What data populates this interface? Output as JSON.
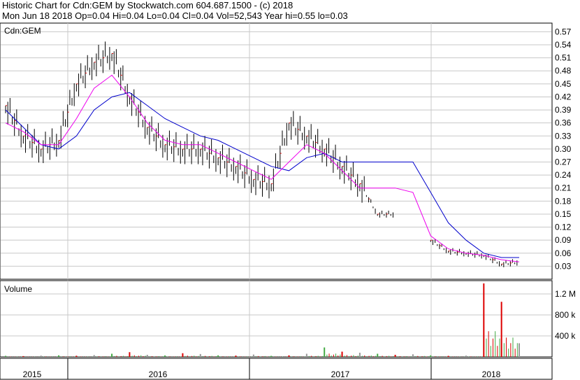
{
  "header": {
    "line1": "Historic Chart for Cdn:GEM by Stockwatch.com 604.687.1500 - (c) 2018",
    "line2": "Mon Jun 18 2018  Op=0.04  Hi=0.04  Lo=0.04  Cl=0.04  Vol=52,543  Year hi=0.55  lo=0.03"
  },
  "colors": {
    "price_bar": "#000000",
    "down_tick": "#dd0000",
    "ma_short": "#ee00ee",
    "ma_long": "#0000cc",
    "vol_up": "#44aa44",
    "vol_down": "#dd0000",
    "vol_flat": "#999999",
    "grid": "#c8c8c8"
  },
  "chart_data": [
    {
      "type": "line",
      "title": "Cdn:GEM",
      "ylim": [
        0.0,
        0.59
      ],
      "y_ticks": [
        "0.57",
        "0.54",
        "0.51",
        "0.48",
        "0.45",
        "0.42",
        "0.39",
        "0.36",
        "0.33",
        "0.30",
        "0.27",
        "0.24",
        "0.21",
        "0.18",
        "0.15",
        "0.12",
        "0.09",
        "0.06",
        "0.03"
      ],
      "x_ticks": [
        "2015",
        "2016",
        "2017",
        "2018"
      ],
      "x": [
        "2015-07",
        "2015-09",
        "2015-11",
        "2016-01",
        "2016-02",
        "2016-03",
        "2016-04",
        "2016-05",
        "2016-06",
        "2016-07",
        "2016-08",
        "2016-09",
        "2016-10",
        "2016-11",
        "2016-12",
        "2017-01",
        "2017-02",
        "2017-03",
        "2017-04",
        "2017-05",
        "2017-06",
        "2017-07",
        "2017-09",
        "2017-11",
        "2017-12",
        "2018-01",
        "2018-03",
        "2018-04",
        "2018-05",
        "2018-06"
      ],
      "series": [
        {
          "values": [
            0.4,
            0.33,
            0.3,
            0.32,
            0.45,
            0.5,
            0.52,
            0.42,
            0.35,
            0.31,
            0.3,
            0.3,
            0.28,
            0.26,
            0.23,
            0.22,
            0.36,
            0.33,
            0.3,
            0.26,
            0.22,
            0.15,
            0.15,
            0.15,
            0.09,
            0.065,
            0.06,
            0.055,
            0.035,
            0.04
          ]
        },
        {
          "values": [
            0.36,
            0.34,
            0.31,
            0.31,
            0.37,
            0.44,
            0.47,
            0.42,
            0.36,
            0.32,
            0.31,
            0.31,
            0.29,
            0.27,
            0.25,
            0.23,
            0.27,
            0.31,
            0.29,
            0.25,
            0.21,
            0.21,
            0.21,
            0.2,
            0.1,
            0.07,
            0.06,
            0.055,
            0.045,
            0.04
          ]
        },
        {
          "values": [
            0.39,
            0.35,
            0.31,
            0.3,
            0.33,
            0.39,
            0.42,
            0.43,
            0.4,
            0.37,
            0.35,
            0.33,
            0.32,
            0.3,
            0.28,
            0.26,
            0.25,
            0.28,
            0.29,
            0.27,
            0.27,
            0.27,
            0.27,
            0.27,
            0.2,
            0.13,
            0.09,
            0.06,
            0.05,
            0.05
          ]
        }
      ]
    },
    {
      "type": "bar",
      "title": "Volume",
      "ylim": [
        0,
        1400000
      ],
      "y_ticks": [
        "1.2 M",
        "800 k",
        "400 k"
      ],
      "series": [
        {
          "values": [
            20000,
            15000,
            25000,
            30000,
            22000,
            35000,
            60000,
            90000,
            40000,
            28000,
            70000,
            55000,
            30000,
            25000,
            45000,
            20000,
            30000,
            60000,
            180000,
            100000,
            80000,
            60000,
            40000,
            50000,
            30000,
            20000,
            25000,
            1400000,
            1050000,
            260000
          ]
        }
      ]
    }
  ]
}
